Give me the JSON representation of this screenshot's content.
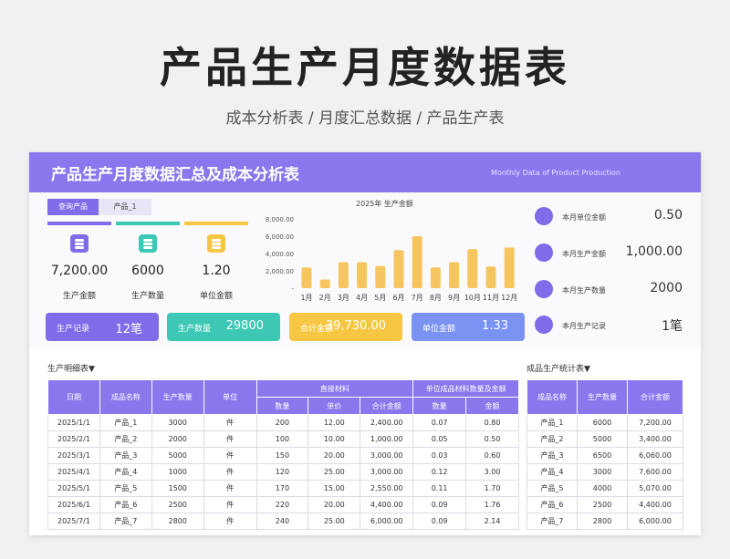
{
  "title": "产品生产月度数据表",
  "subtitle": "成本分析表 / 月度汇总数据 / 产品生产表",
  "banner": {
    "title": "产品生产月度数据汇总及成本分析表",
    "english": "Monthly Data of Product Production"
  },
  "query": {
    "label": "查询产品",
    "value": "产品_1"
  },
  "kpis": [
    {
      "icon": "database-icon",
      "value": "7,200.00",
      "label": "生产金额",
      "color": "#7f6ce9"
    },
    {
      "icon": "database-icon",
      "value": "6000",
      "label": "生产数量",
      "color": "#3cc8b4"
    },
    {
      "icon": "database-icon",
      "value": "1.20",
      "label": "单位金额",
      "color": "#f7c744"
    }
  ],
  "chart_data": {
    "type": "bar",
    "title": "2025年 生产金额",
    "categories": [
      "1月",
      "2月",
      "3月",
      "4月",
      "5月",
      "6月",
      "7月",
      "8月",
      "9月",
      "10月",
      "11月",
      "12月"
    ],
    "values": [
      2400,
      1000,
      3000,
      3000,
      2550,
      4400,
      6000,
      2400,
      3000,
      4500,
      2500,
      4700
    ],
    "ylim": [
      0,
      8000
    ],
    "yticks": [
      "8,000.00",
      "6,000.00",
      "4,000.00",
      "2,000.00",
      "-"
    ],
    "xlabel": "",
    "ylabel": "",
    "grid": false,
    "bar_color": "#f7c560"
  },
  "monthly": [
    {
      "label": "本月单位金额",
      "value": "0.50",
      "icon": "bar-chart-icon"
    },
    {
      "label": "本月生产金额",
      "value": "1,000.00",
      "icon": "document-icon"
    },
    {
      "label": "本月生产数量",
      "value": "2000",
      "icon": "pie-chart-icon"
    },
    {
      "label": "本月生产记录",
      "value": "1笔",
      "icon": "bar-chart-icon"
    }
  ],
  "stats": [
    {
      "label": "生产记录",
      "value": "12笔",
      "color": "#7f6ce9"
    },
    {
      "label": "生产数量",
      "value": "29800",
      "color": "#3cc8b4"
    },
    {
      "label": "合计金额",
      "value": "39,730.00",
      "color": "#f7c744"
    },
    {
      "label": "单位金额",
      "value": "1.33",
      "color": "#7a93f2"
    }
  ],
  "detail": {
    "section": "生产明细表▼",
    "group1": "直接材料",
    "group2": "单位成品材料数量及金额",
    "headers": [
      "日期",
      "成品名称",
      "生产数量",
      "单位",
      "数量",
      "单价",
      "合计金额",
      "数量",
      "金额"
    ],
    "rows": [
      [
        "2025/1/1",
        "产品_1",
        "3000",
        "件",
        "200",
        "12.00",
        "2,400.00",
        "0.07",
        "0.80"
      ],
      [
        "2025/2/1",
        "产品_2",
        "2000",
        "件",
        "100",
        "10.00",
        "1,000.00",
        "0.05",
        "0.50"
      ],
      [
        "2025/3/1",
        "产品_3",
        "5000",
        "件",
        "150",
        "20.00",
        "3,000.00",
        "0.03",
        "0.60"
      ],
      [
        "2025/4/1",
        "产品_4",
        "1000",
        "件",
        "120",
        "25.00",
        "3,000.00",
        "0.12",
        "3.00"
      ],
      [
        "2025/5/1",
        "产品_5",
        "1500",
        "件",
        "170",
        "15.00",
        "2,550.00",
        "0.11",
        "1.70"
      ],
      [
        "2025/6/1",
        "产品_6",
        "2500",
        "件",
        "220",
        "20.00",
        "4,400.00",
        "0.09",
        "1.76"
      ],
      [
        "2025/7/1",
        "产品_7",
        "2800",
        "件",
        "240",
        "25.00",
        "6,000.00",
        "0.09",
        "2.14"
      ]
    ]
  },
  "summary": {
    "section": "成品生产统计表▼",
    "headers": [
      "成品名称",
      "生产数量",
      "合计金额"
    ],
    "rows": [
      [
        "产品_1",
        "6000",
        "7,200.00"
      ],
      [
        "产品_2",
        "5000",
        "3,400.00"
      ],
      [
        "产品_3",
        "6500",
        "6,060.00"
      ],
      [
        "产品_4",
        "3000",
        "7,600.00"
      ],
      [
        "产品_5",
        "4000",
        "5,070.00"
      ],
      [
        "产品_6",
        "2500",
        "4,400.00"
      ],
      [
        "产品_7",
        "2800",
        "6,000.00"
      ]
    ]
  }
}
